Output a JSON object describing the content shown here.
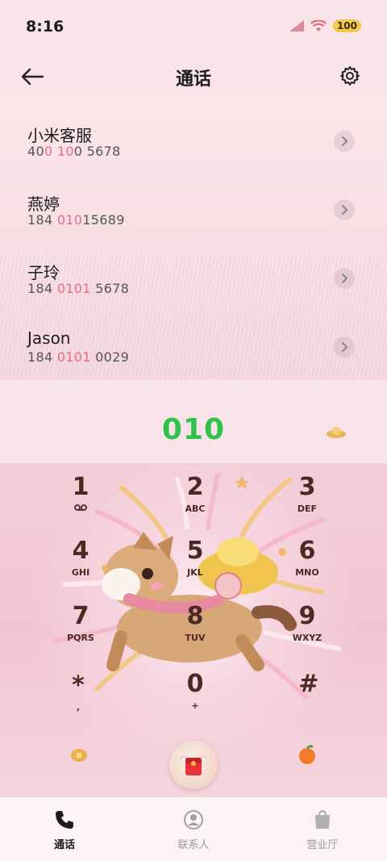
{
  "status_bar": {
    "time": "8:16",
    "battery": "100"
  },
  "header": {
    "title": "通话"
  },
  "contacts": [
    {
      "name": "小米客服",
      "number_parts": [
        "40",
        "0 10",
        "0 5678"
      ]
    },
    {
      "name": "燕婷",
      "number_parts": [
        "184 ",
        "010",
        "15689"
      ]
    },
    {
      "name": "子玲",
      "number_parts": [
        "184 ",
        "0101",
        " 5678"
      ]
    },
    {
      "name": "Jason",
      "number_parts": [
        "184 ",
        "0101",
        " 0029"
      ]
    }
  ],
  "dialed_number": "010",
  "keypad": [
    {
      "digit": "1",
      "letters": ""
    },
    {
      "digit": "2",
      "letters": "ABC"
    },
    {
      "digit": "3",
      "letters": "DEF"
    },
    {
      "digit": "4",
      "letters": "GHI"
    },
    {
      "digit": "5",
      "letters": "JKL"
    },
    {
      "digit": "6",
      "letters": "MNO"
    },
    {
      "digit": "7",
      "letters": "PQRS"
    },
    {
      "digit": "8",
      "letters": "TUV"
    },
    {
      "digit": "9",
      "letters": "WXYZ"
    },
    {
      "digit": "*",
      "letters": ","
    },
    {
      "digit": "0",
      "letters": "+"
    },
    {
      "digit": "#",
      "letters": ""
    }
  ],
  "bottom_nav": [
    {
      "label": "通话",
      "icon": "phone-icon",
      "active": true
    },
    {
      "label": "联系人",
      "icon": "person-icon",
      "active": false
    },
    {
      "label": "营业厅",
      "icon": "bag-icon",
      "active": false
    }
  ],
  "colors": {
    "accent_green": "#2fc34b",
    "highlight_pink": "#e96a8c",
    "key_text": "#4a2a22"
  },
  "icons": {
    "voicemail": "voicemail-icon",
    "call_button": "red-envelope-icon"
  }
}
